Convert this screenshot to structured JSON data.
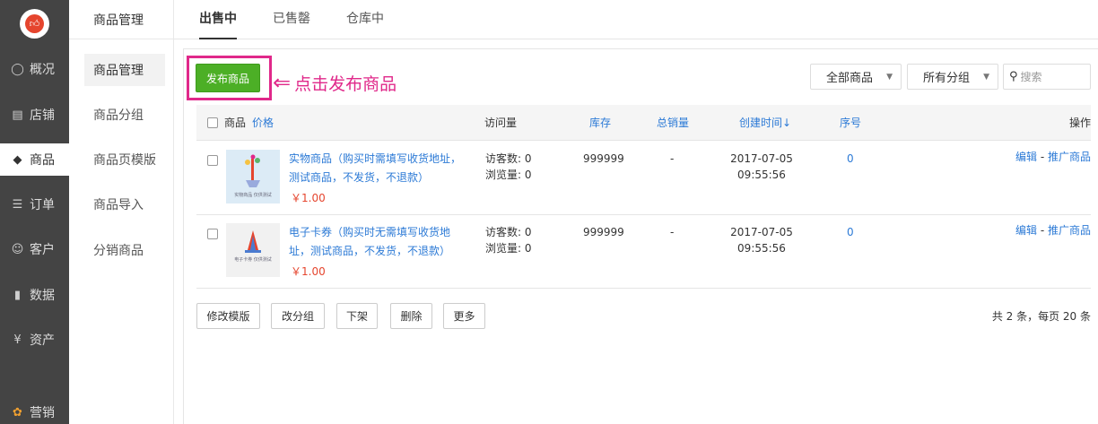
{
  "sidebar": {
    "logo_icon": "thumbs-up-icon",
    "items": [
      {
        "label": "概况",
        "icon": "overview-icon"
      },
      {
        "label": "店铺",
        "icon": "store-icon"
      },
      {
        "label": "商品",
        "icon": "tag-icon"
      },
      {
        "label": "订单",
        "icon": "order-icon"
      },
      {
        "label": "客户",
        "icon": "customer-icon"
      },
      {
        "label": "数据",
        "icon": "chart-icon"
      },
      {
        "label": "资产",
        "icon": "yen-icon"
      },
      {
        "label": "营销",
        "icon": "marketing-icon"
      }
    ]
  },
  "subnav": {
    "title": "商品管理",
    "items": [
      {
        "label": "商品管理"
      },
      {
        "label": "商品分组"
      },
      {
        "label": "商品页模版"
      },
      {
        "label": "商品导入"
      },
      {
        "label": "分销商品"
      }
    ]
  },
  "tabs": [
    {
      "label": "出售中"
    },
    {
      "label": "已售罄"
    },
    {
      "label": "仓库中"
    }
  ],
  "toolbar": {
    "publish_label": "发布商品",
    "annotation": "点击发布商品",
    "filter_all": "全部商品",
    "filter_group": "所有分组",
    "search_placeholder": "搜索"
  },
  "table": {
    "headers": {
      "product": "商品",
      "price": "价格",
      "visits": "访问量",
      "stock": "库存",
      "sales": "总销量",
      "created": "创建时间↓",
      "seq": "序号",
      "ops": "操作"
    },
    "rows": [
      {
        "name": "实物商品（购买时需填写收货地址，测试商品，不发货，不退款）",
        "price": "￥1.00",
        "thumb_caption": "实物商品 仅供测试",
        "visitors": "访客数: 0",
        "views": "浏览量: 0",
        "stock": "999999",
        "sales": "-",
        "date": "2017-07-05",
        "time": "09:55:56",
        "seq": "0",
        "edit": "编辑",
        "promote": "推广商品"
      },
      {
        "name": "电子卡券（购买时无需填写收货地址，测试商品，不发货，不退款）",
        "price": "￥1.00",
        "thumb_caption": "电子卡券 仅供测试",
        "visitors": "访客数: 0",
        "views": "浏览量: 0",
        "stock": "999999",
        "sales": "-",
        "date": "2017-07-05",
        "time": "09:55:56",
        "seq": "0",
        "edit": "编辑",
        "promote": "推广商品"
      }
    ]
  },
  "footer": {
    "buttons": [
      "修改模版",
      "改分组",
      "下架",
      "删除",
      "更多"
    ],
    "summary": "共 2 条，每页 20 条"
  },
  "colors": {
    "sidebar_bg": "#444444",
    "primary_green": "#4caf26",
    "link_blue": "#2c7ad6",
    "annotation_pink": "#e0288a",
    "price_red": "#e5452e"
  }
}
